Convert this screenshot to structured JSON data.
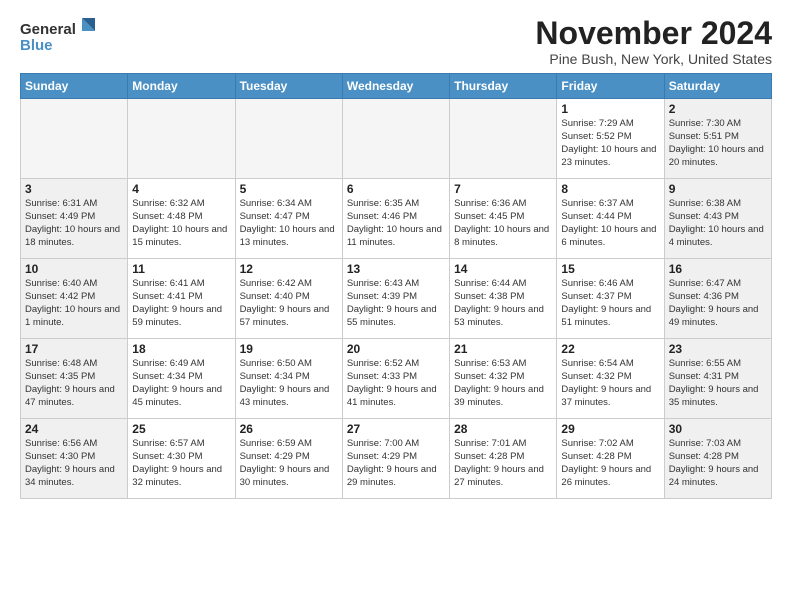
{
  "header": {
    "title": "November 2024",
    "location": "Pine Bush, New York, United States",
    "logo_line1": "General",
    "logo_line2": "Blue"
  },
  "weekdays": [
    "Sunday",
    "Monday",
    "Tuesday",
    "Wednesday",
    "Thursday",
    "Friday",
    "Saturday"
  ],
  "weeks": [
    [
      {
        "day": "",
        "info": "",
        "empty": true,
        "weekend": false
      },
      {
        "day": "",
        "info": "",
        "empty": true,
        "weekend": false
      },
      {
        "day": "",
        "info": "",
        "empty": true,
        "weekend": false
      },
      {
        "day": "",
        "info": "",
        "empty": true,
        "weekend": false
      },
      {
        "day": "",
        "info": "",
        "empty": true,
        "weekend": false
      },
      {
        "day": "1",
        "info": "Sunrise: 7:29 AM\nSunset: 5:52 PM\nDaylight: 10 hours and 23 minutes.",
        "empty": false,
        "weekend": false
      },
      {
        "day": "2",
        "info": "Sunrise: 7:30 AM\nSunset: 5:51 PM\nDaylight: 10 hours and 20 minutes.",
        "empty": false,
        "weekend": true
      }
    ],
    [
      {
        "day": "3",
        "info": "Sunrise: 6:31 AM\nSunset: 4:49 PM\nDaylight: 10 hours and 18 minutes.",
        "empty": false,
        "weekend": true
      },
      {
        "day": "4",
        "info": "Sunrise: 6:32 AM\nSunset: 4:48 PM\nDaylight: 10 hours and 15 minutes.",
        "empty": false,
        "weekend": false
      },
      {
        "day": "5",
        "info": "Sunrise: 6:34 AM\nSunset: 4:47 PM\nDaylight: 10 hours and 13 minutes.",
        "empty": false,
        "weekend": false
      },
      {
        "day": "6",
        "info": "Sunrise: 6:35 AM\nSunset: 4:46 PM\nDaylight: 10 hours and 11 minutes.",
        "empty": false,
        "weekend": false
      },
      {
        "day": "7",
        "info": "Sunrise: 6:36 AM\nSunset: 4:45 PM\nDaylight: 10 hours and 8 minutes.",
        "empty": false,
        "weekend": false
      },
      {
        "day": "8",
        "info": "Sunrise: 6:37 AM\nSunset: 4:44 PM\nDaylight: 10 hours and 6 minutes.",
        "empty": false,
        "weekend": false
      },
      {
        "day": "9",
        "info": "Sunrise: 6:38 AM\nSunset: 4:43 PM\nDaylight: 10 hours and 4 minutes.",
        "empty": false,
        "weekend": true
      }
    ],
    [
      {
        "day": "10",
        "info": "Sunrise: 6:40 AM\nSunset: 4:42 PM\nDaylight: 10 hours and 1 minute.",
        "empty": false,
        "weekend": true
      },
      {
        "day": "11",
        "info": "Sunrise: 6:41 AM\nSunset: 4:41 PM\nDaylight: 9 hours and 59 minutes.",
        "empty": false,
        "weekend": false
      },
      {
        "day": "12",
        "info": "Sunrise: 6:42 AM\nSunset: 4:40 PM\nDaylight: 9 hours and 57 minutes.",
        "empty": false,
        "weekend": false
      },
      {
        "day": "13",
        "info": "Sunrise: 6:43 AM\nSunset: 4:39 PM\nDaylight: 9 hours and 55 minutes.",
        "empty": false,
        "weekend": false
      },
      {
        "day": "14",
        "info": "Sunrise: 6:44 AM\nSunset: 4:38 PM\nDaylight: 9 hours and 53 minutes.",
        "empty": false,
        "weekend": false
      },
      {
        "day": "15",
        "info": "Sunrise: 6:46 AM\nSunset: 4:37 PM\nDaylight: 9 hours and 51 minutes.",
        "empty": false,
        "weekend": false
      },
      {
        "day": "16",
        "info": "Sunrise: 6:47 AM\nSunset: 4:36 PM\nDaylight: 9 hours and 49 minutes.",
        "empty": false,
        "weekend": true
      }
    ],
    [
      {
        "day": "17",
        "info": "Sunrise: 6:48 AM\nSunset: 4:35 PM\nDaylight: 9 hours and 47 minutes.",
        "empty": false,
        "weekend": true
      },
      {
        "day": "18",
        "info": "Sunrise: 6:49 AM\nSunset: 4:34 PM\nDaylight: 9 hours and 45 minutes.",
        "empty": false,
        "weekend": false
      },
      {
        "day": "19",
        "info": "Sunrise: 6:50 AM\nSunset: 4:34 PM\nDaylight: 9 hours and 43 minutes.",
        "empty": false,
        "weekend": false
      },
      {
        "day": "20",
        "info": "Sunrise: 6:52 AM\nSunset: 4:33 PM\nDaylight: 9 hours and 41 minutes.",
        "empty": false,
        "weekend": false
      },
      {
        "day": "21",
        "info": "Sunrise: 6:53 AM\nSunset: 4:32 PM\nDaylight: 9 hours and 39 minutes.",
        "empty": false,
        "weekend": false
      },
      {
        "day": "22",
        "info": "Sunrise: 6:54 AM\nSunset: 4:32 PM\nDaylight: 9 hours and 37 minutes.",
        "empty": false,
        "weekend": false
      },
      {
        "day": "23",
        "info": "Sunrise: 6:55 AM\nSunset: 4:31 PM\nDaylight: 9 hours and 35 minutes.",
        "empty": false,
        "weekend": true
      }
    ],
    [
      {
        "day": "24",
        "info": "Sunrise: 6:56 AM\nSunset: 4:30 PM\nDaylight: 9 hours and 34 minutes.",
        "empty": false,
        "weekend": true
      },
      {
        "day": "25",
        "info": "Sunrise: 6:57 AM\nSunset: 4:30 PM\nDaylight: 9 hours and 32 minutes.",
        "empty": false,
        "weekend": false
      },
      {
        "day": "26",
        "info": "Sunrise: 6:59 AM\nSunset: 4:29 PM\nDaylight: 9 hours and 30 minutes.",
        "empty": false,
        "weekend": false
      },
      {
        "day": "27",
        "info": "Sunrise: 7:00 AM\nSunset: 4:29 PM\nDaylight: 9 hours and 29 minutes.",
        "empty": false,
        "weekend": false
      },
      {
        "day": "28",
        "info": "Sunrise: 7:01 AM\nSunset: 4:28 PM\nDaylight: 9 hours and 27 minutes.",
        "empty": false,
        "weekend": false
      },
      {
        "day": "29",
        "info": "Sunrise: 7:02 AM\nSunset: 4:28 PM\nDaylight: 9 hours and 26 minutes.",
        "empty": false,
        "weekend": false
      },
      {
        "day": "30",
        "info": "Sunrise: 7:03 AM\nSunset: 4:28 PM\nDaylight: 9 hours and 24 minutes.",
        "empty": false,
        "weekend": true
      }
    ]
  ]
}
